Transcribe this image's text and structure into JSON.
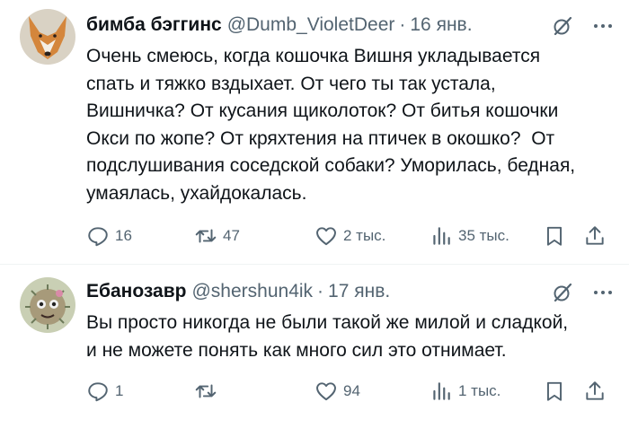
{
  "tweets": [
    {
      "name": "бимба бэггинс",
      "handle": "@Dumb_VioletDeer",
      "separator": "·",
      "date": "16 янв.",
      "text": "Очень смеюсь, когда кошочка Вишня укладывается\nспать и тяжко вздыхает. От чего ты так устала,\nВишничка? От кусания щиколоток? От битья кошочки\nОкси по жопе? От кряхтения на птичек в окошко?  От\nподслушивания соседской собаки? Уморилась, бедная,\nумаялась, ухайдокалась.",
      "replies": "16",
      "retweets": "47",
      "likes": "2 тыс.",
      "views": "35 тыс."
    },
    {
      "name": "Ебанозавр",
      "handle": "@shershun4ik",
      "separator": "·",
      "date": "17 янв.",
      "text": "Вы просто никогда не были такой же милой и сладкой,\nи не можете понять как много сил это отнимает.",
      "replies": "1",
      "retweets": "",
      "likes": "94",
      "views": "1 тыс."
    }
  ],
  "icons": {
    "reply": "reply-icon",
    "retweet": "retweet-icon",
    "like": "heart-icon",
    "views": "views-chart-icon",
    "bookmark": "bookmark-icon",
    "share": "share-icon",
    "grok": "grok-icon",
    "more": "more-icon"
  },
  "colors": {
    "secondary_text": "#536471",
    "primary_text": "#0f1419",
    "divider": "#eff3f4"
  }
}
